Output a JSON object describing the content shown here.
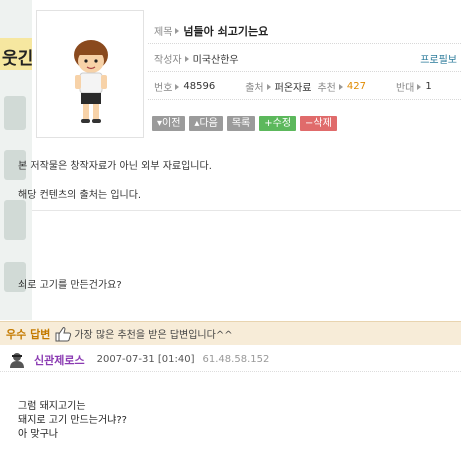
{
  "side": {
    "title": "웃긴"
  },
  "post": {
    "title_label": "제목",
    "title": "넘들아 쇠고기는요",
    "author_label": "작성자",
    "author": "미국산한우",
    "profile_label": "프로필보",
    "number_label": "번호",
    "number": "48596",
    "source_label": "출처",
    "source": "퍼온자료",
    "recommend_label": "추천",
    "recommend": "427",
    "oppose_label": "반대",
    "oppose": "1"
  },
  "buttons": {
    "prev": "▾이전",
    "next": "▴다음",
    "list": "목록",
    "edit": "+수정",
    "delete": "−삭제"
  },
  "content": {
    "notice1": "본 저작물은 창작자료가 아닌 외부 자료입니다.",
    "notice2": "해당 컨텐츠의 출처는 입니다.",
    "question": "쇠로 고기를 만든건가요?"
  },
  "best_answer": {
    "label": "우수 답변",
    "text": "가장 많은 추천을 받은 답변입니다^^"
  },
  "answer": {
    "author": "신관제로스",
    "date": "2007-07-31 [01:40]",
    "ip": "61.48.58.152",
    "lines": [
      "그럼 돼지고기는",
      "돼지로 고기 만드는거냐??",
      "아 맞구나"
    ]
  }
}
